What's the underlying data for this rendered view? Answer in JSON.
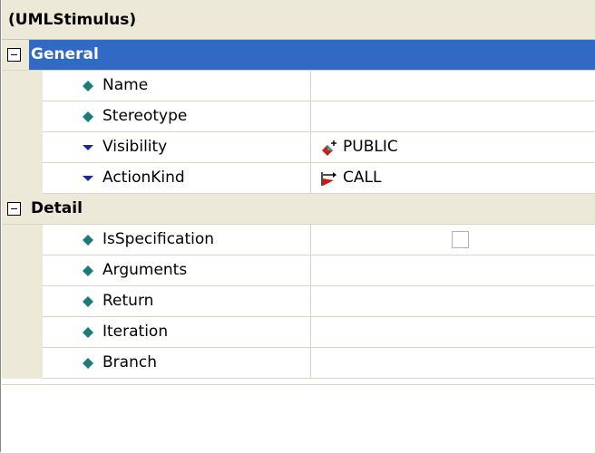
{
  "object_title": "(UMLStimulus)",
  "categories": [
    {
      "label": "General",
      "selected": true,
      "properties": [
        {
          "name": "Name",
          "icon": "diamond-icon",
          "value": ""
        },
        {
          "name": "Stereotype",
          "icon": "diamond-icon",
          "value": ""
        },
        {
          "name": "Visibility",
          "icon": "triangle-down-icon",
          "value": "PUBLIC",
          "value_icon": "visibility-public-icon"
        },
        {
          "name": "ActionKind",
          "icon": "triangle-down-icon",
          "value": "CALL",
          "value_icon": "action-call-icon"
        }
      ]
    },
    {
      "label": "Detail",
      "selected": false,
      "properties": [
        {
          "name": "IsSpecification",
          "icon": "diamond-icon",
          "value": "",
          "value_type": "checkbox",
          "checked": false
        },
        {
          "name": "Arguments",
          "icon": "diamond-icon",
          "value": ""
        },
        {
          "name": "Return",
          "icon": "diamond-icon",
          "value": ""
        },
        {
          "name": "Iteration",
          "icon": "diamond-icon",
          "value": ""
        },
        {
          "name": "Branch",
          "icon": "diamond-icon",
          "value": ""
        }
      ]
    }
  ],
  "colors": {
    "selection": "#316ac5",
    "chrome": "#ece9d8",
    "diamond_icon": "#1b7a7a",
    "triangle_icon": "#1a2a9a"
  }
}
